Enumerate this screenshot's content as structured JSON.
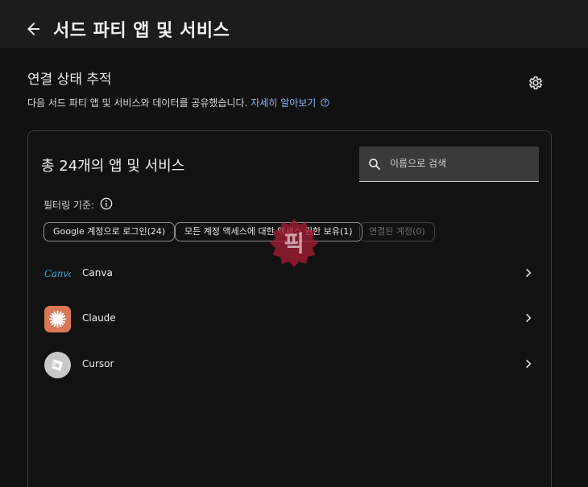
{
  "header": {
    "title": "서드 파티 앱 및 서비스",
    "back_icon": "arrow-left-icon"
  },
  "section": {
    "title": "연결 상태 추적",
    "description": "다음 서드 파티 앱 및 서비스와 데이터를 공유했습니다.",
    "learn_more": "자세히 알아보기",
    "settings_icon": "gear-icon"
  },
  "card": {
    "title": "총 24개의 앱 및 서비스",
    "search": {
      "placeholder": "이름으로 검색",
      "value": ""
    },
    "filter_label": "필터링 기준:",
    "chips": [
      {
        "label": "Google 계정으로 로그인(24)",
        "enabled": true
      },
      {
        "label": "모든 계정 액세스에 대한 액세스 권한 보유(1)",
        "enabled": true
      },
      {
        "label": "연결된 계정(0)",
        "enabled": false
      }
    ],
    "apps": [
      {
        "name": "Canva",
        "logo_text": "Canva",
        "logo_color": "#3aa9d6"
      },
      {
        "name": "Claude",
        "logo_color": "#d97757"
      },
      {
        "name": "Cursor",
        "logo_color": "#c9c9c9"
      }
    ]
  },
  "watermark": {
    "text": "픽",
    "color": "#b0203a"
  },
  "colors": {
    "accent_link": "#8ab4f8",
    "background": "#111111",
    "topbar": "#1c1c1c"
  }
}
